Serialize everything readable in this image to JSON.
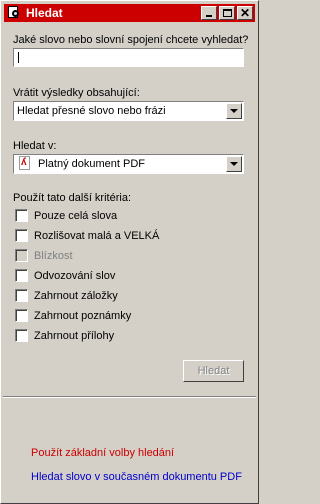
{
  "window": {
    "title": "Hledat",
    "accent": "#cc0000"
  },
  "search": {
    "question_label": "Jaké slovo nebo slovní spojení chcete vyhledat?",
    "value": ""
  },
  "results": {
    "label": "Vrátit výsledky obsahující:",
    "selected": "Hledat přesné slovo nebo frázi"
  },
  "scope": {
    "label": "Hledat v:",
    "selected": "Platný dokument PDF",
    "icon": "pdf-document-icon"
  },
  "criteria": {
    "label": "Použít tato další kritéria:",
    "items": [
      {
        "label": "Pouze celá slova",
        "checked": false,
        "disabled": false
      },
      {
        "label": "Rozlišovat malá a VELKÁ",
        "checked": false,
        "disabled": false
      },
      {
        "label": "Blízkost",
        "checked": false,
        "disabled": true
      },
      {
        "label": "Odvozování slov",
        "checked": false,
        "disabled": false
      },
      {
        "label": "Zahrnout záložky",
        "checked": false,
        "disabled": false
      },
      {
        "label": "Zahrnout poznámky",
        "checked": false,
        "disabled": false
      },
      {
        "label": "Zahrnout přílohy",
        "checked": false,
        "disabled": false
      }
    ]
  },
  "actions": {
    "search_button": "Hledat"
  },
  "links": {
    "basic_options": "Použít základní volby hledání",
    "basic_options_color": "#cc0000",
    "search_current": "Hledat slovo v současném dokumentu PDF",
    "search_current_color": "#0000cc"
  }
}
